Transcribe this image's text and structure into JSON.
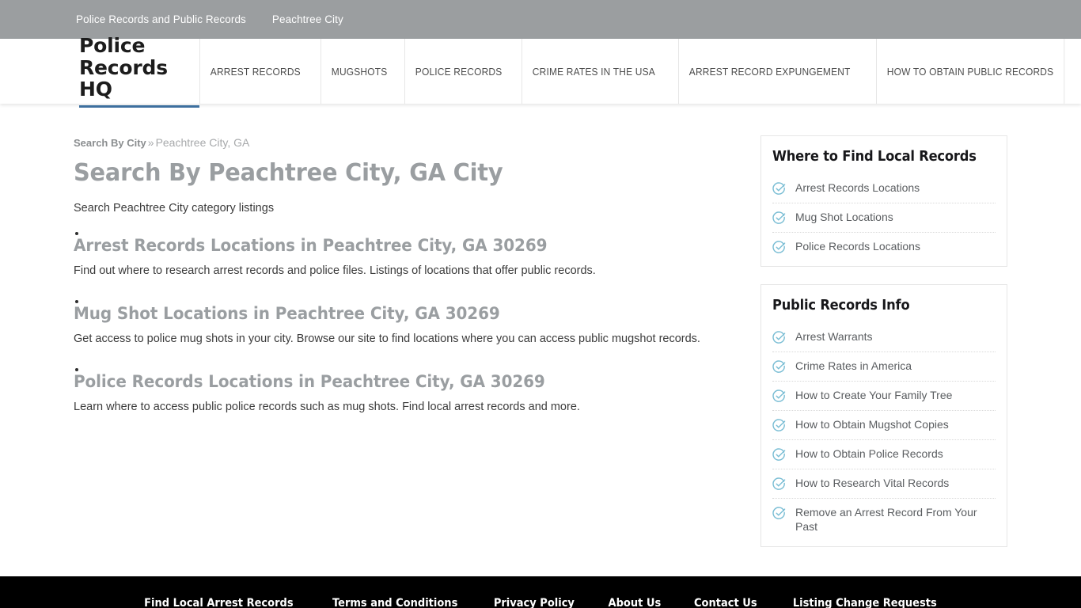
{
  "topbar": {
    "links": [
      {
        "label": "Police Records and Public Records"
      },
      {
        "label": "Peachtree City"
      }
    ]
  },
  "header": {
    "brand": "Police Records HQ",
    "brand_underline_color": "#3d6f9e",
    "nav": [
      {
        "label": "ARREST RECORDS"
      },
      {
        "label": "MUGSHOTS"
      },
      {
        "label": "POLICE RECORDS"
      },
      {
        "label": "CRIME RATES IN THE USA"
      },
      {
        "label": "ARREST RECORD EXPUNGEMENT"
      },
      {
        "label": "HOW TO OBTAIN PUBLIC RECORDS"
      }
    ]
  },
  "breadcrumb": {
    "root": "Search By City",
    "separator": "»",
    "current": "Peachtree City, GA"
  },
  "main": {
    "title": "Search By Peachtree City, GA City",
    "subtitle": "Search Peachtree City category listings",
    "categories": [
      {
        "title": "Arrest Records Locations in Peachtree City, GA 30269",
        "description": "Find out where to research arrest records and police files. Listings of locations that offer public records."
      },
      {
        "title": "Mug Shot Locations in Peachtree City, GA 30269",
        "description": "Get access to police mug shots in your city. Browse our site to find locations where you can access public mugshot records."
      },
      {
        "title": "Police Records Locations in Peachtree City, GA 30269",
        "description": "Learn where to access public police records such as mug shots. Find local arrest records and more."
      }
    ]
  },
  "sidebar": {
    "icon_color": "#79bdd4",
    "widgets": [
      {
        "title": "Where to Find Local Records",
        "items": [
          {
            "label": "Arrest Records Locations",
            "icon": "check-circle-icon"
          },
          {
            "label": "Mug Shot Locations",
            "icon": "check-circle-icon"
          },
          {
            "label": "Police Records Locations",
            "icon": "check-circle-icon"
          }
        ]
      },
      {
        "title": "Public Records Info",
        "items": [
          {
            "label": "Arrest Warrants",
            "icon": "check-circle-icon"
          },
          {
            "label": "Crime Rates in America",
            "icon": "check-circle-icon"
          },
          {
            "label": "How to Create Your Family Tree",
            "icon": "check-circle-icon"
          },
          {
            "label": "How to Obtain Mugshot Copies",
            "icon": "check-circle-icon"
          },
          {
            "label": "How to Obtain Police Records",
            "icon": "check-circle-icon"
          },
          {
            "label": "How to Research Vital Records",
            "icon": "check-circle-icon"
          },
          {
            "label": "Remove an Arrest Record From Your Past",
            "icon": "check-circle-icon"
          }
        ]
      }
    ]
  },
  "footer": {
    "links": [
      {
        "label": "Find Local Arrest Records"
      },
      {
        "label": "Terms and Conditions"
      },
      {
        "label": "Privacy Policy"
      },
      {
        "label": "About Us"
      },
      {
        "label": "Contact Us"
      },
      {
        "label": "Listing Change Requests"
      }
    ]
  }
}
